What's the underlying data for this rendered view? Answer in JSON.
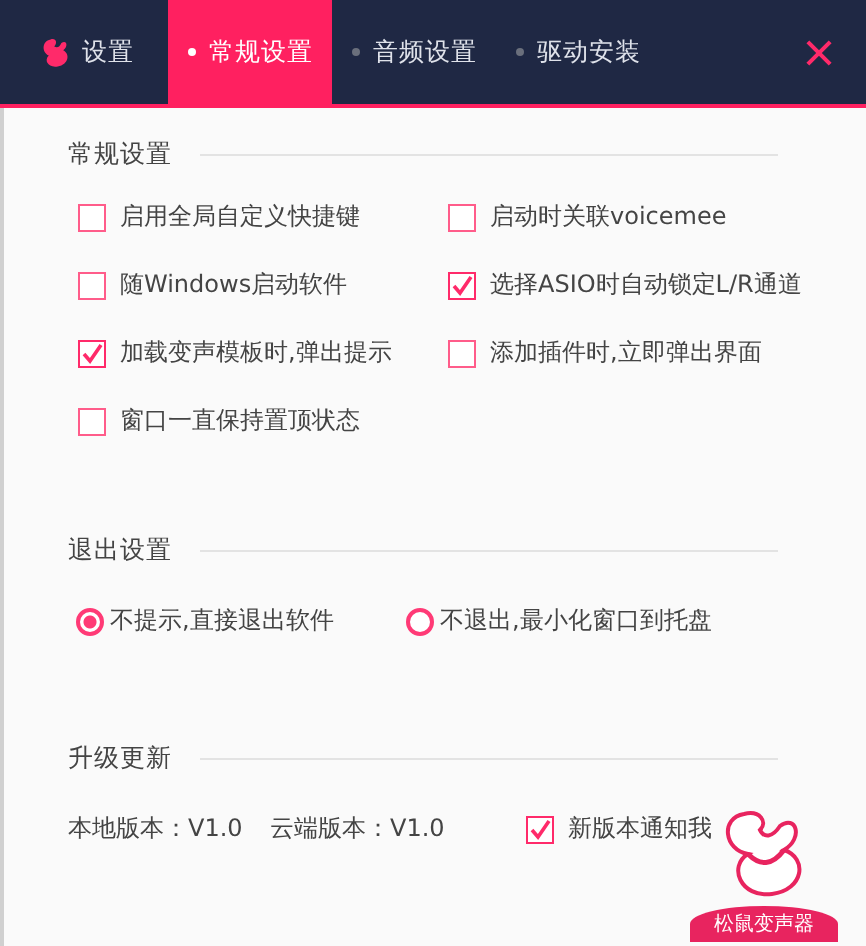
{
  "tabs": [
    {
      "kind": "logo",
      "label": "设置",
      "selected": false
    },
    {
      "kind": "page",
      "label": "常规设置",
      "selected": true
    },
    {
      "kind": "page",
      "label": "音频设置",
      "selected": false
    },
    {
      "kind": "page",
      "label": "驱动安装",
      "selected": false
    }
  ],
  "general": {
    "title": "常规设置",
    "options": [
      {
        "label": "启用全局自定义快捷键",
        "checked": false
      },
      {
        "label": "启动时关联voicemee",
        "checked": false
      },
      {
        "label": "随Windows启动软件",
        "checked": false
      },
      {
        "label": "选择ASIO时自动锁定L/R通道",
        "checked": true
      },
      {
        "label": "加载变声模板时,弹出提示",
        "checked": true
      },
      {
        "label": "添加插件时,立即弹出界面",
        "checked": false
      },
      {
        "label": "窗口一直保持置顶状态",
        "checked": false
      }
    ]
  },
  "exit": {
    "title": "退出设置",
    "options": [
      {
        "label": "不提示,直接退出软件",
        "selected": true
      },
      {
        "label": "不退出,最小化窗口到托盘",
        "selected": false
      }
    ]
  },
  "update": {
    "title": "升级更新",
    "local_version": "本地版本：V1.0",
    "cloud_version": "云端版本：V1.0",
    "notify": {
      "label": "新版本通知我",
      "checked": true
    }
  },
  "brand": {
    "caption": "松鼠变声器"
  }
}
